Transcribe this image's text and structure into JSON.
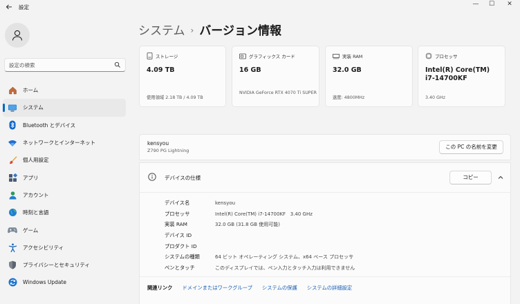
{
  "app": {
    "title": "設定"
  },
  "window": {
    "minimize": "—",
    "maximize": "☐",
    "close": "✕"
  },
  "search": {
    "placeholder": "設定の検索"
  },
  "sidebar": {
    "items": [
      {
        "label": "ホーム",
        "icon": "home-icon"
      },
      {
        "label": "システム",
        "icon": "system-icon",
        "selected": true
      },
      {
        "label": "Bluetooth とデバイス",
        "icon": "bluetooth-icon"
      },
      {
        "label": "ネットワークとインターネット",
        "icon": "wifi-icon"
      },
      {
        "label": "個人用設定",
        "icon": "brush-icon"
      },
      {
        "label": "アプリ",
        "icon": "apps-icon"
      },
      {
        "label": "アカウント",
        "icon": "account-icon"
      },
      {
        "label": "時刻と言語",
        "icon": "globe-icon"
      },
      {
        "label": "ゲーム",
        "icon": "gamepad-icon"
      },
      {
        "label": "アクセシビリティ",
        "icon": "accessibility-icon"
      },
      {
        "label": "プライバシーとセキュリティ",
        "icon": "shield-icon"
      },
      {
        "label": "Windows Update",
        "icon": "update-icon"
      }
    ]
  },
  "breadcrumb": {
    "parent": "システム",
    "separator": "›",
    "current": "バージョン情報"
  },
  "cards": {
    "storage": {
      "label": "ストレージ",
      "value": "4.09 TB",
      "sub": "使用領域 2.18 TB / 4.09 TB"
    },
    "gpu": {
      "label": "グラフィックス カード",
      "value": "16 GB",
      "sub": "NVIDIA GeForce RTX 4070 Ti SUPER"
    },
    "ram": {
      "label": "実装 RAM",
      "value": "32.0 GB",
      "sub": "速度: 4800MHz"
    },
    "cpu": {
      "label": "プロセッサ",
      "value": "Intel(R) Core(TM) i7-14700KF",
      "sub": "3.40 GHz"
    }
  },
  "device": {
    "name": "kensyou",
    "model": "Z790 PG Lightning",
    "rename_button": "この PC の名前を変更"
  },
  "spec": {
    "title": "デバイスの仕様",
    "copy_button": "コピー",
    "rows": [
      {
        "label": "デバイス名",
        "value": "kensyou"
      },
      {
        "label": "プロセッサ",
        "value": "Intel(R) Core(TM) i7-14700KF   3.40 GHz"
      },
      {
        "label": "実装 RAM",
        "value": "32.0 GB (31.8 GB 使用可能)"
      },
      {
        "label": "デバイス ID",
        "value": ""
      },
      {
        "label": "プロダクト ID",
        "value": ""
      },
      {
        "label": "システムの種類",
        "value": "64 ビット オペレーティング システム、x64 ベース プロセッサ"
      },
      {
        "label": "ペンとタッチ",
        "value": "このディスプレイでは、ペン入力とタッチ入力は利用できません"
      }
    ]
  },
  "related": {
    "label": "関連リンク",
    "links": [
      "ドメインまたはワークグループ",
      "システムの保護",
      "システムの詳細設定"
    ]
  },
  "colors": {
    "accent": "#0067c0",
    "link": "#1a5fb4",
    "background": "#f3f3f3",
    "card": "#fbfbfb"
  }
}
